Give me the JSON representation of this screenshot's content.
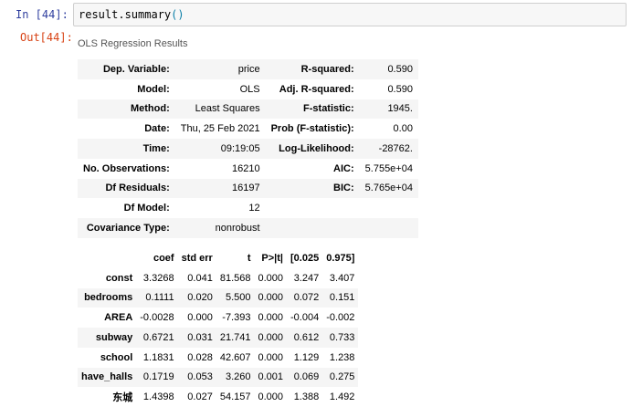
{
  "input": {
    "prompt": "In  [44]:",
    "code_name": "result.summary",
    "code_parens": "()"
  },
  "output": {
    "prompt": "Out[44]:",
    "caption": "OLS Regression Results"
  },
  "summary_rows": [
    [
      "Dep. Variable:",
      "price",
      "R-squared:",
      "0.590"
    ],
    [
      "Model:",
      "OLS",
      "Adj. R-squared:",
      "0.590"
    ],
    [
      "Method:",
      "Least Squares",
      "F-statistic:",
      "1945."
    ],
    [
      "Date:",
      "Thu, 25 Feb 2021",
      "Prob (F-statistic):",
      "0.00"
    ],
    [
      "Time:",
      "09:19:05",
      "Log-Likelihood:",
      "-28762."
    ],
    [
      "No. Observations:",
      "16210",
      "AIC:",
      "5.755e+04"
    ],
    [
      "Df Residuals:",
      "16197",
      "BIC:",
      "5.765e+04"
    ],
    [
      "Df Model:",
      "12",
      "",
      ""
    ],
    [
      "Covariance Type:",
      "nonrobust",
      "",
      ""
    ]
  ],
  "coef_headers": [
    "",
    "coef",
    "std err",
    "t",
    "P>|t|",
    "[0.025",
    "0.975]"
  ],
  "coef_rows": [
    [
      "const",
      "3.3268",
      "0.041",
      "81.568",
      "0.000",
      "3.247",
      "3.407"
    ],
    [
      "bedrooms",
      "0.1111",
      "0.020",
      "5.500",
      "0.000",
      "0.072",
      "0.151"
    ],
    [
      "AREA",
      "-0.0028",
      "0.000",
      "-7.393",
      "0.000",
      "-0.004",
      "-0.002"
    ],
    [
      "subway",
      "0.6721",
      "0.031",
      "21.741",
      "0.000",
      "0.612",
      "0.733"
    ],
    [
      "school",
      "1.1831",
      "0.028",
      "42.607",
      "0.000",
      "1.129",
      "1.238"
    ],
    [
      "have_halls",
      "0.1719",
      "0.053",
      "3.260",
      "0.001",
      "0.069",
      "0.275"
    ],
    [
      "东城",
      "1.4398",
      "0.027",
      "54.157",
      "0.000",
      "1.388",
      "1.492"
    ]
  ]
}
